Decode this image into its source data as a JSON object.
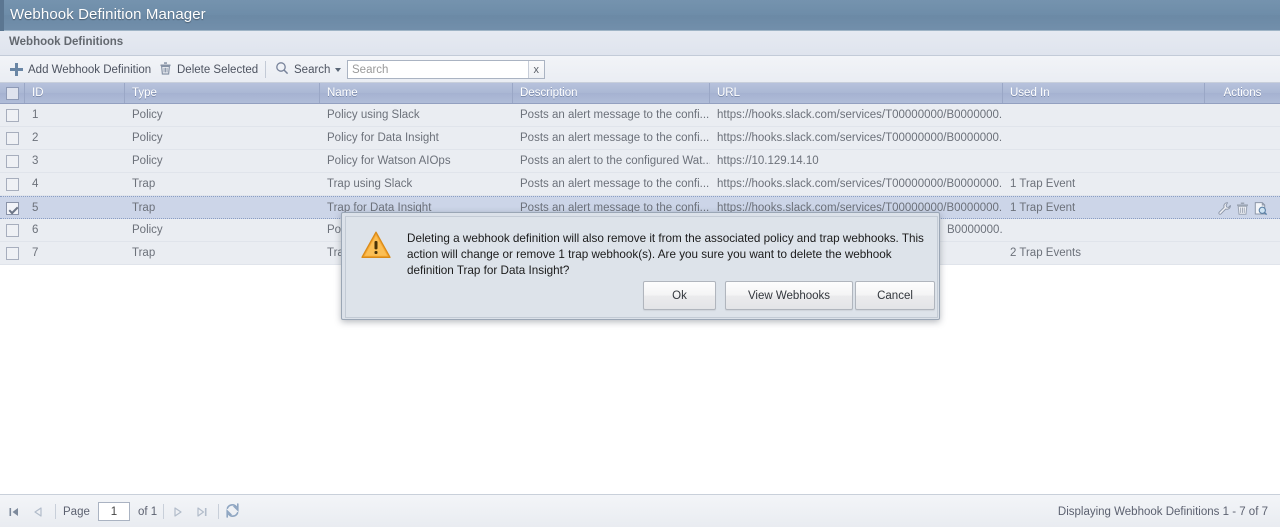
{
  "window": {
    "title": "Webhook Definition Manager"
  },
  "panel": {
    "title": "Webhook Definitions"
  },
  "toolbar": {
    "add_label": "Add Webhook Definition",
    "add_icon": "plus-icon",
    "delete_label": "Delete Selected",
    "delete_icon": "trash-icon",
    "search_label": "Search",
    "search_icon": "magnifier-icon",
    "search_caret_icon": "chevron-down-icon",
    "search_value": "",
    "search_placeholder": "Search",
    "search_clear_label": "x"
  },
  "grid": {
    "columns": [
      {
        "key": "checkbox",
        "label": ""
      },
      {
        "key": "id",
        "label": "ID"
      },
      {
        "key": "type",
        "label": "Type"
      },
      {
        "key": "name",
        "label": "Name"
      },
      {
        "key": "description",
        "label": "Description"
      },
      {
        "key": "url",
        "label": "URL"
      },
      {
        "key": "used_in",
        "label": "Used In"
      },
      {
        "key": "actions",
        "label": "Actions"
      }
    ],
    "rows": [
      {
        "checked": false,
        "id": "1",
        "type": "Policy",
        "name": "Policy using Slack",
        "description": "Posts an alert message to the confi...",
        "url": "https://hooks.slack.com/services/T00000000/B0000000...",
        "used_in": "",
        "show_actions": false
      },
      {
        "checked": false,
        "id": "2",
        "type": "Policy",
        "name": "Policy for Data Insight",
        "description": "Posts an alert message to the confi...",
        "url": "https://hooks.slack.com/services/T00000000/B0000000...",
        "used_in": "",
        "show_actions": false
      },
      {
        "checked": false,
        "id": "3",
        "type": "Policy",
        "name": "Policy for Watson AIOps",
        "description": "Posts an alert to the configured Wat...",
        "url": "https://10.129.14.10",
        "used_in": "",
        "show_actions": false
      },
      {
        "checked": false,
        "id": "4",
        "type": "Trap",
        "name": "Trap using Slack",
        "description": "Posts an alert message to the confi...",
        "url": "https://hooks.slack.com/services/T00000000/B0000000...",
        "used_in": "1 Trap Event",
        "show_actions": false
      },
      {
        "checked": true,
        "id": "5",
        "type": "Trap",
        "name": "Trap for Data Insight",
        "description": "Posts an alert message to the confi...",
        "url": "https://hooks.slack.com/services/T00000000/B0000000...",
        "used_in": "1 Trap Event",
        "show_actions": true
      },
      {
        "checked": false,
        "id": "6",
        "type": "Policy",
        "name": "Poli",
        "description": "",
        "url": "B0000000...",
        "used_in": "",
        "show_actions": false
      },
      {
        "checked": false,
        "id": "7",
        "type": "Trap",
        "name": "Tra",
        "description": "",
        "url": "",
        "used_in": "2 Trap Events",
        "show_actions": false
      }
    ],
    "row_actions": {
      "edit_icon": "wrench-icon",
      "delete_icon": "trash-icon",
      "view_icon": "document-search-icon"
    }
  },
  "pager": {
    "first_icon": "first-page-icon",
    "prev_icon": "previous-page-icon",
    "page_label": "Page",
    "page_value": "1",
    "of_label": "of 1",
    "next_icon": "next-page-icon",
    "last_icon": "last-page-icon",
    "refresh_icon": "refresh-icon",
    "status": "Displaying Webhook Definitions 1 - 7 of 7"
  },
  "dialog": {
    "warning_icon": "warning-triangle-icon",
    "message": "Deleting a webhook definition will also remove it from the associated policy and trap webhooks. This action will change or remove 1 trap webhook(s). Are you sure you want to delete the webhook definition Trap for Data Insight?",
    "buttons": {
      "ok": "Ok",
      "view_webhooks": "View Webhooks",
      "cancel": "Cancel"
    }
  },
  "colors": {
    "titlebar": "#6e8da9",
    "grid_header": "#aab7d4",
    "selected_row": "#ccd5e8",
    "row_bg": "#eaedf2",
    "warning": "#f5a623",
    "dialog_bg": "#dde3ea"
  }
}
